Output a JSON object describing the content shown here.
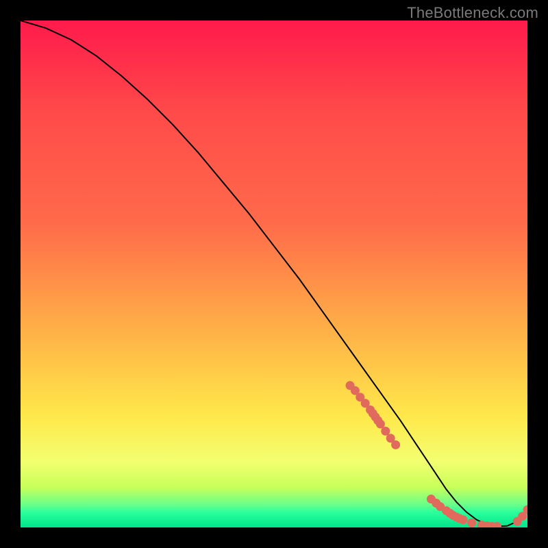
{
  "watermark": "TheBottleneck.com",
  "colors": {
    "top": "#ff1a4b",
    "mid_red_orange": "#ff6b4a",
    "mid_orange": "#ffb347",
    "mid_yellow": "#ffe84a",
    "low_yellow": "#f3ff70",
    "band_yg": "#c8ff5a",
    "band_green": "#2bff9c",
    "bottom_green": "#00e58a",
    "line": "#000000",
    "dot": "#e06a5c",
    "bg": "#000000"
  },
  "chart_data": {
    "type": "line",
    "title": "",
    "xlabel": "",
    "ylabel": "",
    "xlim": [
      0,
      100
    ],
    "ylim": [
      0,
      100
    ],
    "x": [
      0,
      5,
      10,
      15,
      20,
      25,
      30,
      35,
      40,
      45,
      50,
      55,
      60,
      65,
      70,
      75,
      78,
      80,
      82,
      84,
      86,
      88,
      90,
      92,
      93,
      94,
      96,
      98,
      100
    ],
    "values": [
      100,
      98.5,
      96.2,
      93,
      89,
      84.5,
      79.5,
      74,
      68,
      62,
      55.5,
      49,
      42,
      35,
      28,
      21,
      16.5,
      13.5,
      10.5,
      7.5,
      5,
      3,
      1.5,
      0.6,
      0.3,
      0.2,
      0.3,
      1.2,
      3.5
    ],
    "dots_x": [
      65,
      66,
      67,
      68,
      69,
      69.5,
      70,
      70.5,
      71,
      72,
      73,
      74,
      81,
      82,
      82.8,
      84,
      84.7,
      85.3,
      86,
      86.6,
      87.3,
      89,
      91,
      92,
      93,
      94,
      98,
      99,
      100
    ],
    "dots_y": [
      28,
      27,
      25.7,
      24.5,
      23.2,
      22.5,
      21.8,
      21.1,
      20.4,
      19,
      17.6,
      16.3,
      5.6,
      4.8,
      4.1,
      3.3,
      2.8,
      2.4,
      2.05,
      1.75,
      1.5,
      0.9,
      0.45,
      0.3,
      0.2,
      0.2,
      1.2,
      2.2,
      3.5
    ]
  }
}
